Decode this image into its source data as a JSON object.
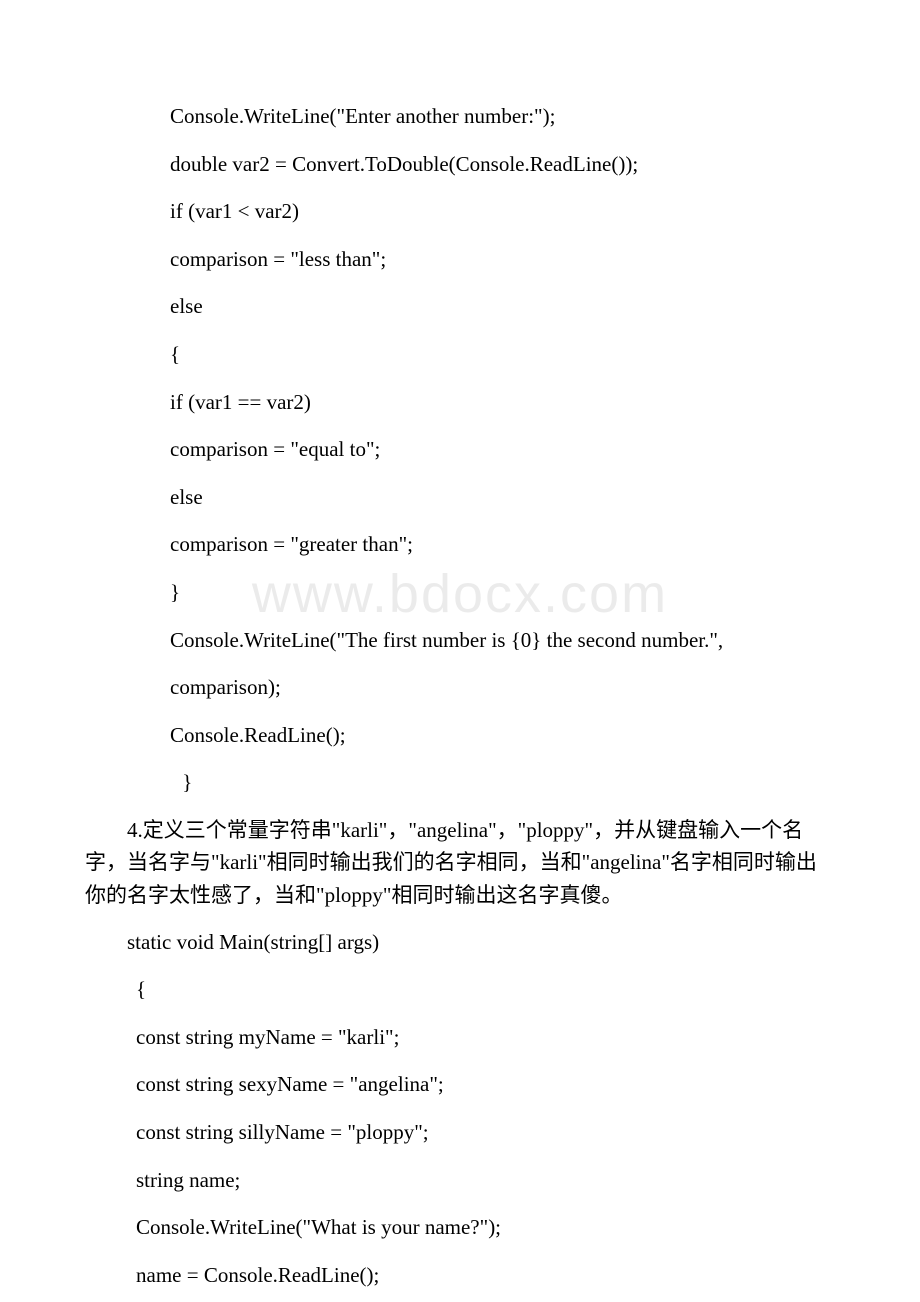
{
  "watermark": "www.bdocx.com",
  "code1": {
    "l1": "Console.WriteLine(\"Enter another number:\");",
    "l2": "double var2 = Convert.ToDouble(Console.ReadLine());",
    "l3": "if (var1 < var2)",
    "l4": "comparison = \"less than\";",
    "l5": "else",
    "l6": "{",
    "l7": "if (var1 == var2)",
    "l8": "comparison = \"equal to\";",
    "l9": "else",
    "l10": "comparison = \"greater than\";",
    "l11": "}",
    "l12": "Console.WriteLine(\"The first number is {0} the second number.\",",
    "l13": "comparison);",
    "l14": "Console.ReadLine();",
    "l15": " }"
  },
  "para": {
    "text": "4.定义三个常量字符串\"karli\"，\"angelina\"，\"ploppy\"，并从键盘输入一个名字，当名字与\"karli\"相同时输出我们的名字相同，当和\"angelina\"名字相同时输出你的名字太性感了，当和\"ploppy\"相同时输出这名字真傻。"
  },
  "code2": {
    "method": "static void Main(string[] args)",
    "l1": "{",
    "l2": "const string myName = \"karli\";",
    "l3": "const string sexyName = \"angelina\";",
    "l4": "const string sillyName = \"ploppy\";",
    "l5": "string name;",
    "l6": "Console.WriteLine(\"What is your name?\");",
    "l7": "name = Console.ReadLine();"
  }
}
